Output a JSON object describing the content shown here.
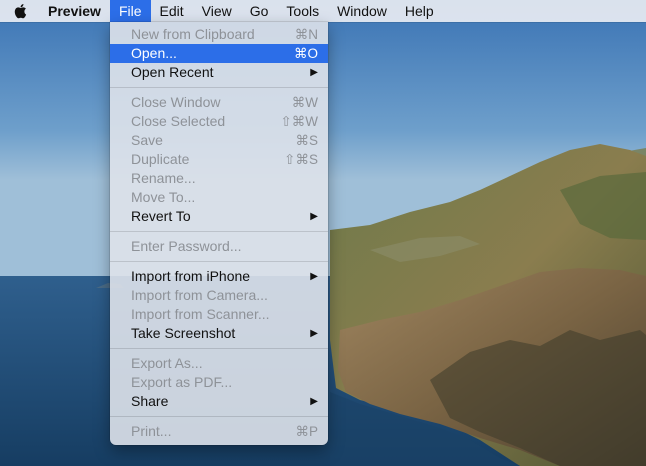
{
  "menubar": {
    "app_name": "Preview",
    "items": [
      "File",
      "Edit",
      "View",
      "Go",
      "Tools",
      "Window",
      "Help"
    ]
  },
  "file_menu": {
    "new_from_clipboard": {
      "label": "New from Clipboard",
      "shortcut": "⌘N"
    },
    "open": {
      "label": "Open...",
      "shortcut": "⌘O"
    },
    "open_recent": {
      "label": "Open Recent",
      "submenu": "▶"
    },
    "close_window": {
      "label": "Close Window",
      "shortcut": "⌘W"
    },
    "close_selected": {
      "label": "Close Selected",
      "shortcut": "⇧⌘W"
    },
    "save": {
      "label": "Save",
      "shortcut": "⌘S"
    },
    "duplicate": {
      "label": "Duplicate",
      "shortcut": "⇧⌘S"
    },
    "rename": {
      "label": "Rename..."
    },
    "move_to": {
      "label": "Move To..."
    },
    "revert_to": {
      "label": "Revert To",
      "submenu": "▶"
    },
    "enter_password": {
      "label": "Enter Password..."
    },
    "import_from_iphone": {
      "label": "Import from iPhone",
      "submenu": "▶"
    },
    "import_from_camera": {
      "label": "Import from Camera..."
    },
    "import_from_scanner": {
      "label": "Import from Scanner..."
    },
    "take_screenshot": {
      "label": "Take Screenshot",
      "submenu": "▶"
    },
    "export_as": {
      "label": "Export As..."
    },
    "export_as_pdf": {
      "label": "Export as PDF..."
    },
    "share": {
      "label": "Share",
      "submenu": "▶"
    },
    "print": {
      "label": "Print...",
      "shortcut": "⌘P"
    }
  },
  "colors": {
    "highlight": "#2c6ee8",
    "disabled_text": "#8e9298",
    "sky_top": "#3f79b8",
    "sea": "#1e4a74"
  }
}
